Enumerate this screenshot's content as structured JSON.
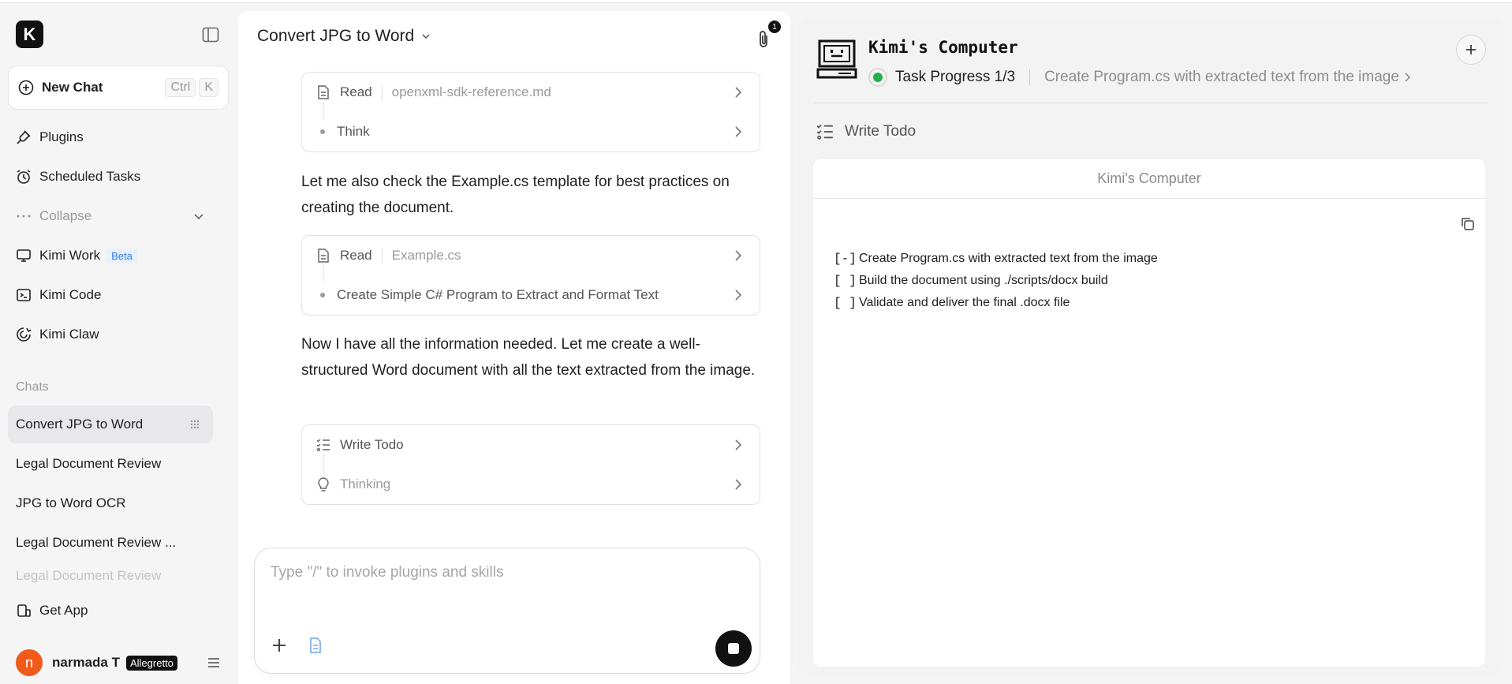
{
  "sidebar": {
    "logo_letter": "K",
    "new_chat": {
      "label": "New Chat",
      "shortcut_ctrl": "Ctrl",
      "shortcut_key": "K"
    },
    "nav": {
      "plugins": "Plugins",
      "scheduled": "Scheduled Tasks",
      "collapse": "Collapse",
      "kimi_work": "Kimi Work",
      "kimi_work_badge": "Beta",
      "kimi_code": "Kimi Code",
      "kimi_claw": "Kimi Claw"
    },
    "chats_heading": "Chats",
    "chats": [
      "Convert JPG to Word",
      "Legal Document Review",
      "JPG to Word OCR",
      "Legal Document Review ...",
      "Legal Document Review"
    ],
    "get_app": "Get App",
    "user": {
      "initial": "n",
      "name": "narmada T",
      "plan": "Allegretto"
    }
  },
  "chat": {
    "title": "Convert JPG to Word",
    "attachment_count": "1",
    "card1": {
      "read_label": "Read",
      "file": "openxml-sdk-reference.md",
      "think": "Think"
    },
    "msg1": "Let me also check the Example.cs template for best practices on creating the document.",
    "card2": {
      "read_label": "Read",
      "file": "Example.cs",
      "step": "Create Simple C# Program to Extract and Format Text"
    },
    "msg2": "Now I have all the information needed. Let me create a well-structured Word document with all the text extracted from the image.",
    "card3": {
      "todo": "Write Todo",
      "thinking": "Thinking"
    },
    "composer_placeholder": "Type \"/\" to invoke plugins and skills"
  },
  "computer": {
    "name": "Kimi's Computer",
    "progress_label": "Task Progress 1/3",
    "current_task": "Create Program.cs with extracted text from the image",
    "section": "Write Todo",
    "viewer_title": "Kimi's Computer",
    "todos": [
      {
        "box": "[-]",
        "text": "Create Program.cs with extracted text from the image"
      },
      {
        "box": "[ ]",
        "text": "Build the document using ./scripts/docx build"
      },
      {
        "box": "[ ]",
        "text": "Validate and deliver the final .docx file"
      }
    ],
    "status_color": "#22b14c"
  }
}
